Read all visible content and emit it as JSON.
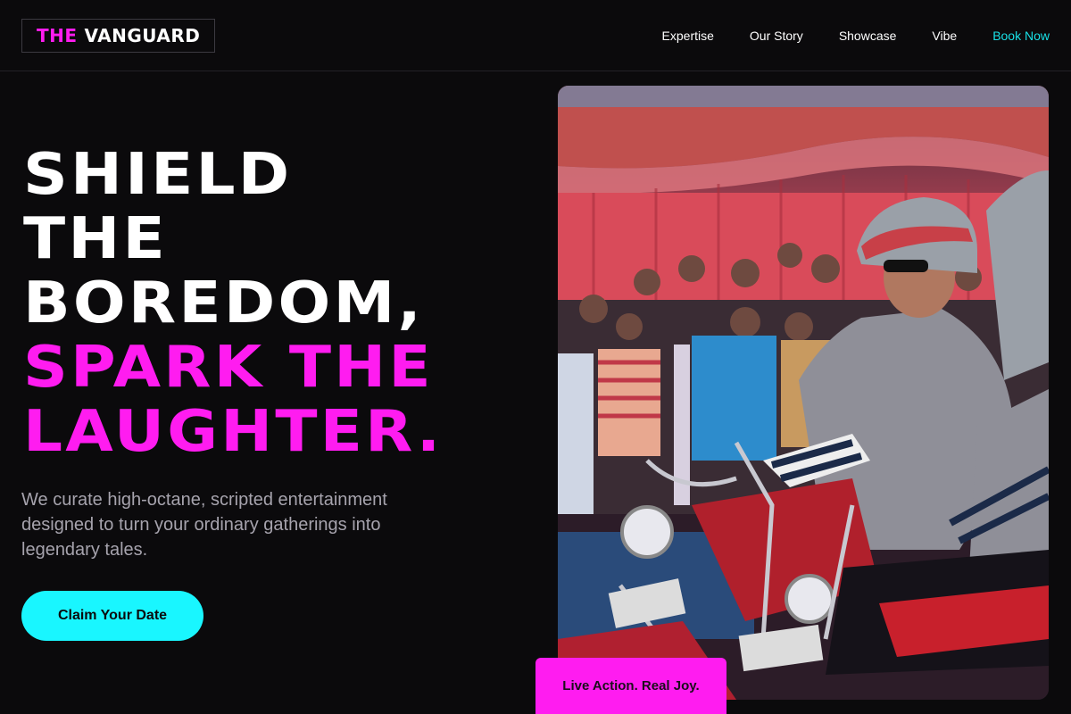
{
  "header": {
    "logo": {
      "accent": "THE",
      "main": "VANGUARD"
    },
    "nav": [
      {
        "label": "Expertise"
      },
      {
        "label": "Our Story"
      },
      {
        "label": "Showcase"
      },
      {
        "label": "Vibe"
      },
      {
        "label": "Book Now"
      }
    ]
  },
  "hero": {
    "title_white": [
      "SHIELD",
      "THE",
      "BOREDOM,"
    ],
    "title_pink": [
      "SPARK THE",
      "LAUGHTER."
    ],
    "description": "We curate high-octane, scripted entertainment designed to turn your ordinary gatherings into legendary tales.",
    "cta_label": "Claim Your Date",
    "badge": "Live Action. Real Joy.",
    "image_alt": "Performers in police costumes riding motorcycles in front of an audience under a red tent"
  },
  "colors": {
    "accent_pink": "#ff1cf0",
    "accent_cyan": "#19f6ff",
    "background": "#0b0a0c"
  }
}
